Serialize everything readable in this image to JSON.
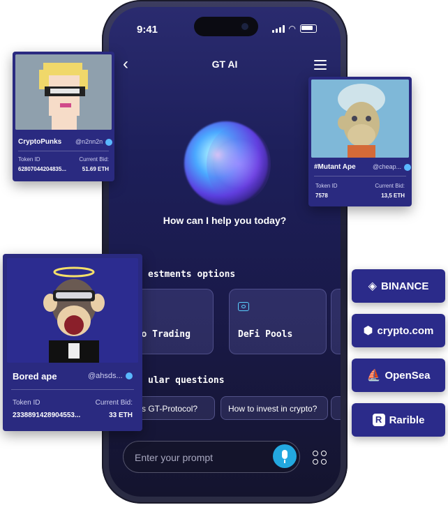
{
  "status": {
    "time": "9:41"
  },
  "header": {
    "title": "GT AI"
  },
  "greeting": "How can I help you today?",
  "sections": {
    "investments": "estments options",
    "popular": "ular questions"
  },
  "cards": [
    {
      "label": "Auto Trading"
    },
    {
      "label": "DeFi Pools"
    }
  ],
  "chips": [
    {
      "label": "at is GT-Protocol?"
    },
    {
      "label": "How to invest in crypto?"
    }
  ],
  "prompt": {
    "placeholder": "Enter your prompt"
  },
  "nfts": {
    "punks": {
      "name": "CryptoPunks",
      "handle": "@n2nn2n",
      "token_label": "Token ID",
      "token": "62807044204835...",
      "bid_label": "Current Bid:",
      "bid": "51.69 ETH"
    },
    "mutant": {
      "name": "#Mutant Ape",
      "handle": "@cheap...",
      "token_label": "Token ID",
      "token": "7578",
      "bid_label": "Current Bid:",
      "bid": "13,5 ETH"
    },
    "bored": {
      "name": "Bored ape",
      "handle": "@ahsds...",
      "token_label": "Token ID",
      "token": "2338891428904553...",
      "bid_label": "Current Bid:",
      "bid": "33 ETH"
    }
  },
  "exchanges": [
    {
      "name": "BINANCE",
      "icon": "binance-icon"
    },
    {
      "name": "crypto.com",
      "icon": "crypto-com-icon"
    },
    {
      "name": "OpenSea",
      "icon": "opensea-icon"
    },
    {
      "name": "Rarible",
      "icon": "rarible-icon"
    }
  ],
  "colors": {
    "accent": "#23a8e0",
    "card": "#2a2a80",
    "screen": "#1d1f5a"
  }
}
